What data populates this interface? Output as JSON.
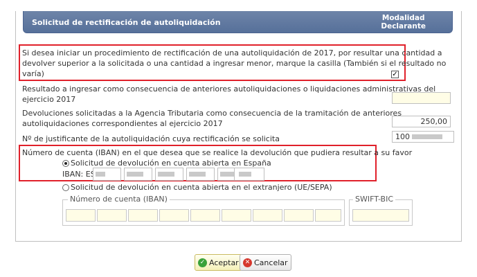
{
  "header": {
    "title": "Solicitud de rectificación de autoliquidación",
    "modalidad_line1": "Modalidad",
    "modalidad_line2": "Declarante"
  },
  "rectificacion": {
    "text_line1": "Si desea iniciar un procedimiento de rectificación de una autoliquidación de 2017, por resultar una cantidad a",
    "text_line2": "devolver superior a la solicitada o una cantidad a ingresar menor, marque la casilla (También si el resultado no",
    "text_line3": "varía)",
    "checked": true,
    "check_glyph": "✓"
  },
  "resultado": {
    "label_line1": "Resultado a ingresar como consecuencia de anteriores autoliquidaciones o liquidaciones administrativas del",
    "label_line2": "ejercicio 2017",
    "value": ""
  },
  "devoluciones": {
    "label_line1": "Devoluciones solicitadas a la Agencia Tributaria como consecuencia de la tramitación de anteriores",
    "label_line2": "autoliquidaciones correspondientes al ejercicio 2017",
    "value": "250,00"
  },
  "justificante": {
    "label": "Nº de justificante de la autoliquidación cuya rectificación se solicita",
    "value_prefix": "100"
  },
  "cuenta": {
    "label": "Número de cuenta (IBAN) en el que desea que se realice la devolución que pudiera resultar a su favor",
    "option_espana": "Solicitud de devolución en cuenta abierta en España",
    "iban_label": "IBAN: ES",
    "option_extranjero": "Solicitud de devolución en cuenta abierta en el extranjero (UE/SEPA)",
    "selected": "espana"
  },
  "extranjero": {
    "iban_legend": "Número de cuenta (IBAN)",
    "swift_legend": "SWIFT-BIC"
  },
  "buttons": {
    "aceptar": "Aceptar",
    "cancelar": "Cancelar"
  },
  "colors": {
    "header": "#5f779f",
    "highlight_border": "#e0202a",
    "input_bg": "#fffde6"
  }
}
